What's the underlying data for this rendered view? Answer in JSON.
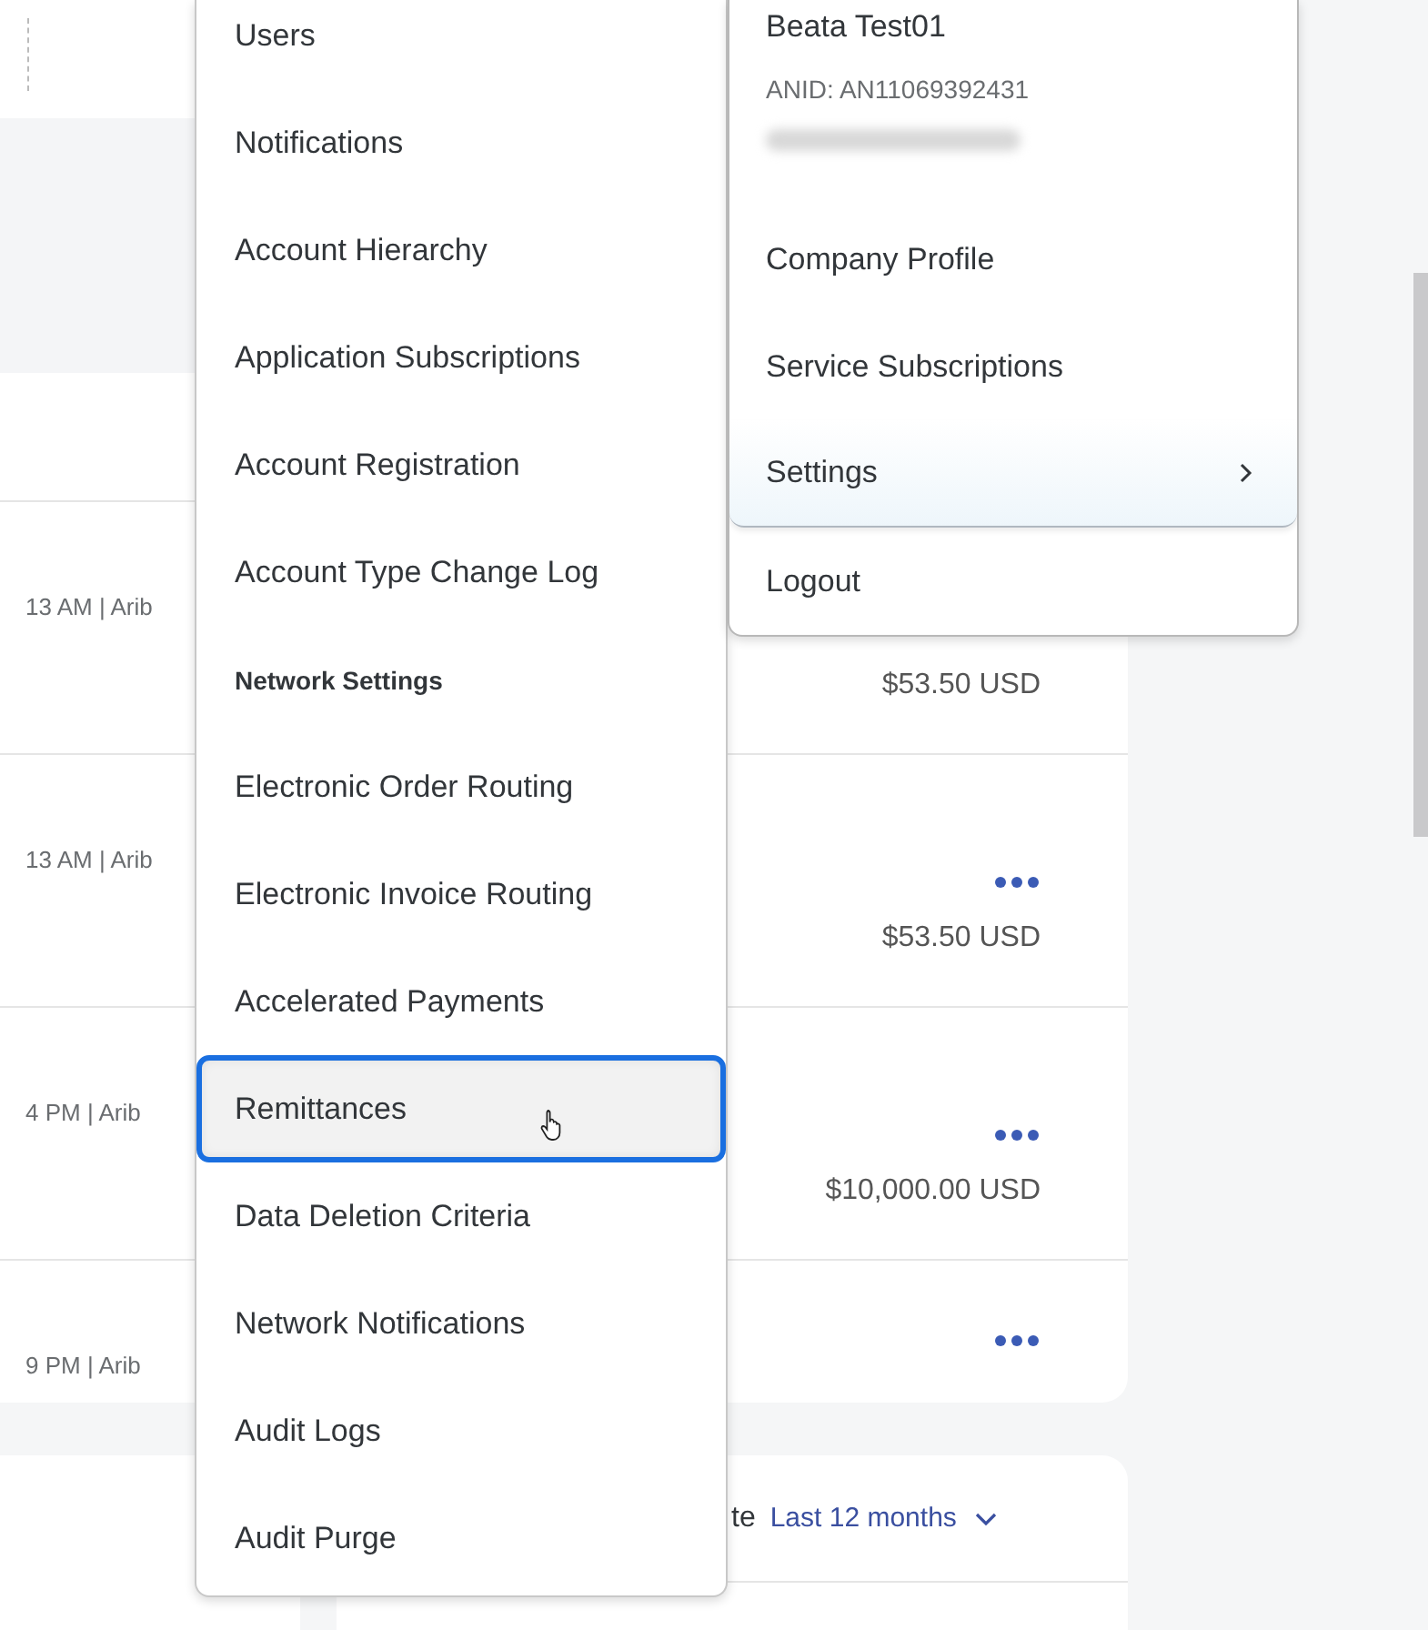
{
  "background": {
    "rows": [
      {
        "meta": "13 AM | Arib",
        "amount": "$53.50 USD",
        "has_actions": false
      },
      {
        "meta": "13 AM | Arib",
        "amount": "$53.50 USD",
        "has_actions": true
      },
      {
        "meta": "4 PM | Arib",
        "amount": "$10,000.00 USD",
        "has_actions": true
      },
      {
        "meta": "9 PM | Arib",
        "has_actions": true
      }
    ],
    "filter": {
      "label": "te",
      "value": "Last 12 months"
    }
  },
  "settings_menu": {
    "items": [
      {
        "label": "Users",
        "kind": "item",
        "selected": false
      },
      {
        "label": "Notifications",
        "kind": "item",
        "selected": false
      },
      {
        "label": "Account Hierarchy",
        "kind": "item",
        "selected": false
      },
      {
        "label": "Application Subscriptions",
        "kind": "item",
        "selected": false
      },
      {
        "label": "Account Registration",
        "kind": "item",
        "selected": false
      },
      {
        "label": "Account Type Change Log",
        "kind": "item",
        "selected": false
      },
      {
        "label": "Network Settings",
        "kind": "header"
      },
      {
        "label": "Electronic Order Routing",
        "kind": "item",
        "selected": false
      },
      {
        "label": "Electronic Invoice Routing",
        "kind": "item",
        "selected": false
      },
      {
        "label": "Accelerated Payments",
        "kind": "item",
        "selected": false
      },
      {
        "label": "Remittances",
        "kind": "item",
        "selected": true
      },
      {
        "label": "Data Deletion Criteria",
        "kind": "item",
        "selected": false
      },
      {
        "label": "Network Notifications",
        "kind": "item",
        "selected": false
      },
      {
        "label": "Audit Logs",
        "kind": "item",
        "selected": false
      },
      {
        "label": "Audit Purge",
        "kind": "item",
        "selected": false
      }
    ]
  },
  "user_menu": {
    "name": "Beata Test01",
    "anid": "ANID: AN11069392431",
    "items": [
      {
        "label": "Company Profile",
        "kind": "item",
        "selected": false
      },
      {
        "label": "Service Subscriptions",
        "kind": "item",
        "selected": false
      },
      {
        "label": "Settings",
        "kind": "submenu",
        "selected": true
      },
      {
        "label": "Logout",
        "kind": "item",
        "selected": false
      }
    ]
  }
}
